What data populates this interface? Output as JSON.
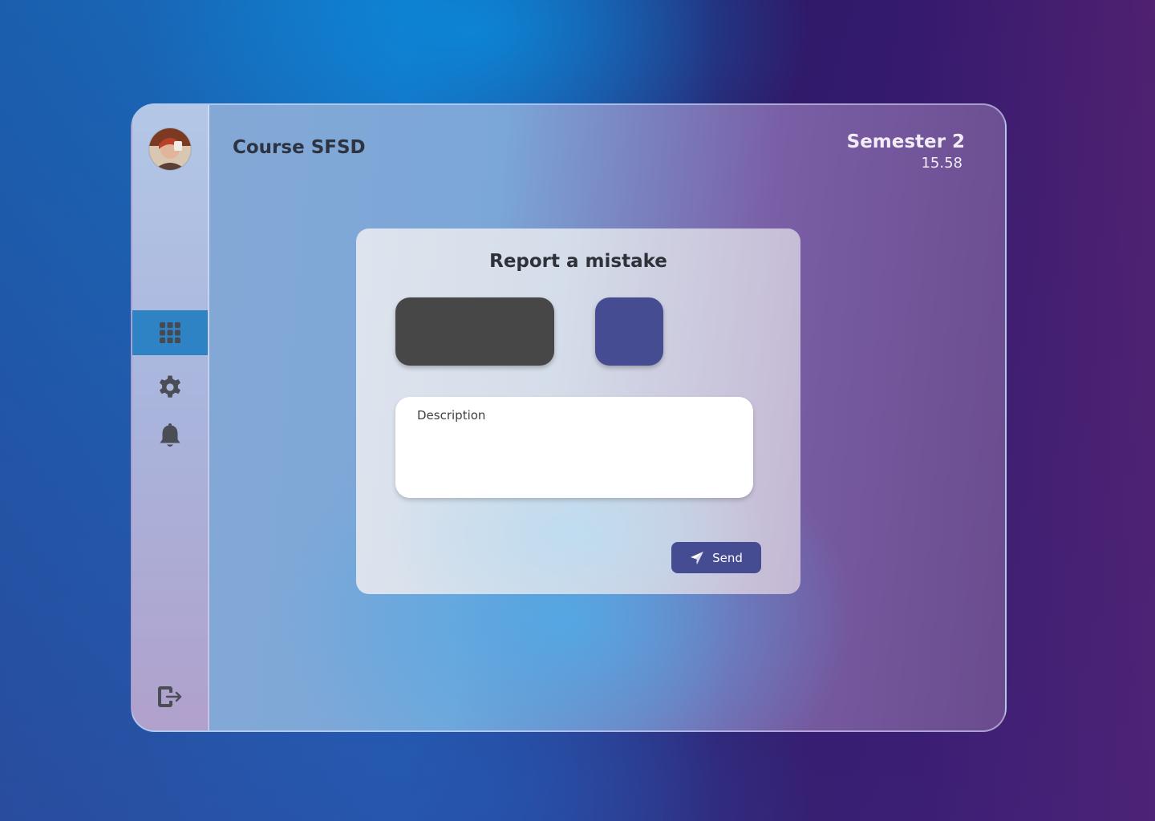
{
  "header": {
    "title": "Course SFSD",
    "semester_label": "Semester 2",
    "semester_value": "15.58"
  },
  "sidebar": {
    "items": [
      {
        "icon": "apps-grid-icon",
        "active": true
      },
      {
        "icon": "gear-icon",
        "active": false
      },
      {
        "icon": "bell-icon",
        "active": false
      }
    ],
    "logout_icon": "logout-icon"
  },
  "dialog": {
    "title": "Report a mistake",
    "description_placeholder": "Description",
    "send_label": "Send",
    "send_icon": "paper-plane-icon"
  },
  "colors": {
    "active_nav": "#2d83c4",
    "accent": "#464c92",
    "dark_option": "#474747",
    "icon": "#4a4d55"
  }
}
